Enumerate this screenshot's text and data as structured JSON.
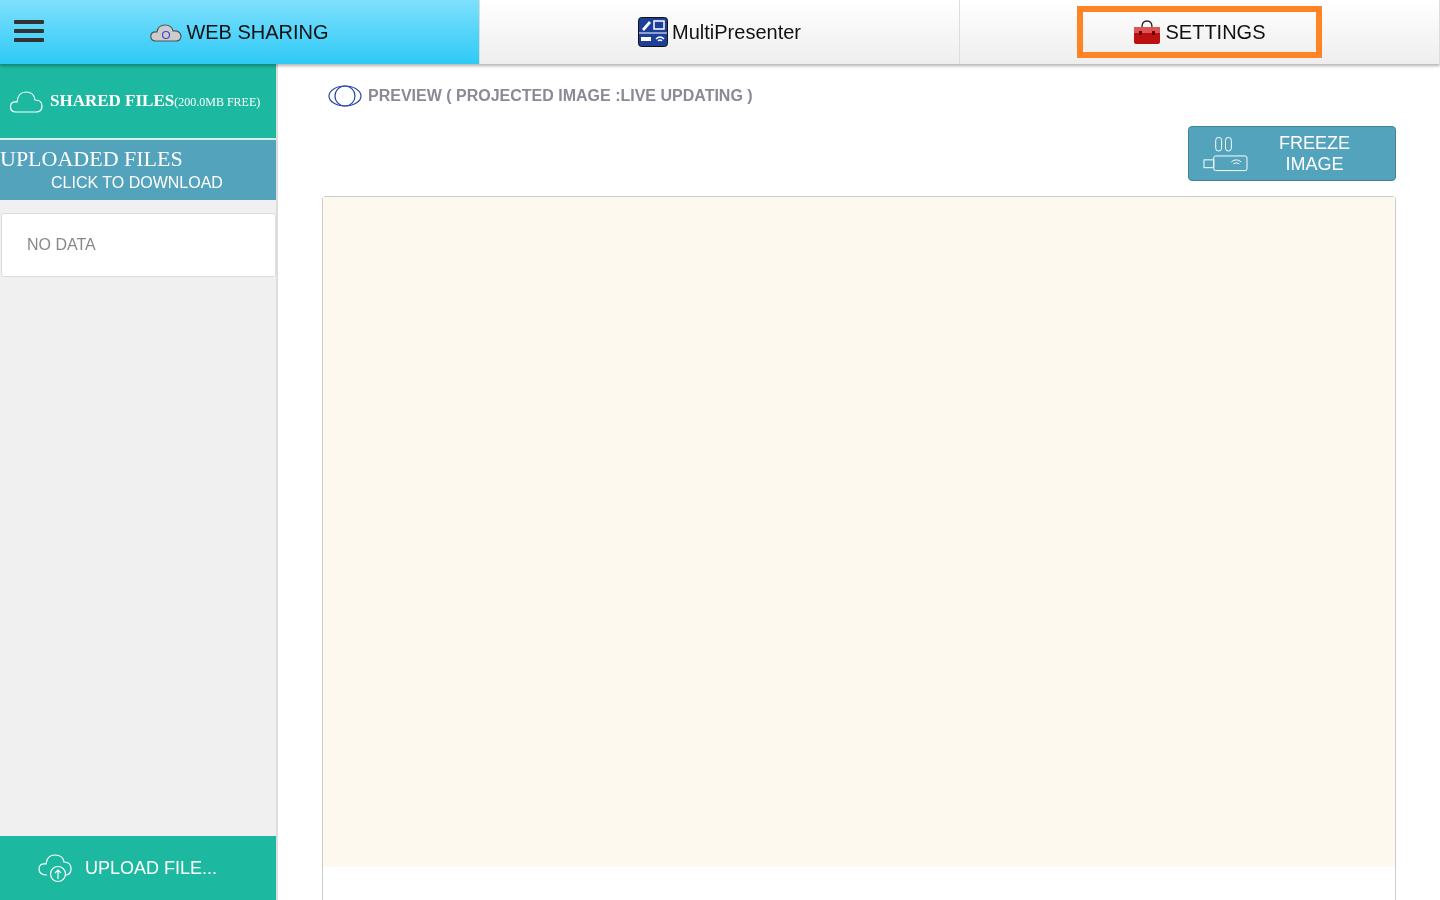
{
  "tabs": [
    {
      "kind": "cloud",
      "label": "WEB SHARING",
      "selected": true,
      "highlighted": false
    },
    {
      "kind": "presenter",
      "label": "MultiPresenter",
      "selected": false,
      "highlighted": false
    },
    {
      "kind": "toolbox",
      "label": "SETTINGS",
      "selected": false,
      "highlighted": true
    }
  ],
  "sidebar": {
    "shared_title": "SHARED FILES",
    "shared_free": "(200.0MB FREE)",
    "uploaded_title": "UPLOADED FILES",
    "uploaded_hint": "CLICK TO DOWNLOAD",
    "empty": "NO DATA",
    "upload_button": "UPLOAD FILE..."
  },
  "preview": {
    "title": "PREVIEW ( PROJECTED IMAGE :LIVE UPDATING )",
    "freeze_button": "FREEZE IMAGE"
  }
}
